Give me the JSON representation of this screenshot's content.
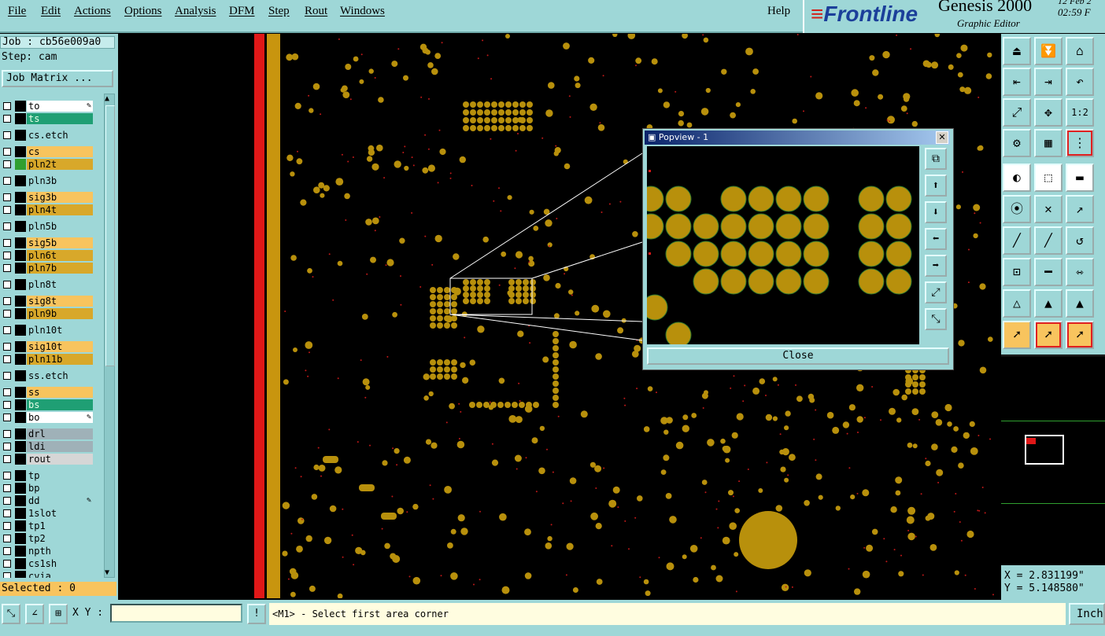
{
  "menu": {
    "items": [
      "File",
      "Edit",
      "Actions",
      "Options",
      "Analysis",
      "DFM",
      "Step",
      "Rout",
      "Windows"
    ],
    "help": "Help"
  },
  "brand": {
    "logo": "Frontline",
    "title": "Genesis 2000",
    "subtitle": "Graphic Editor",
    "date": "12 Feb 2",
    "time": "02:59 F"
  },
  "job": {
    "job_line": "Job : cb56e009a0",
    "step_line": "Step: cam",
    "matrix_button": "Job Matrix ..."
  },
  "layers": [
    {
      "name": "to",
      "color": "#ffffff",
      "editable": true
    },
    {
      "name": "ts",
      "color": "#1f9f74",
      "editable": false
    },
    {
      "name": "cs.etch",
      "color": "#9ed7d7",
      "editable": false
    },
    {
      "name": "cs",
      "color": "#f8c45e",
      "editable": false
    },
    {
      "name": "pln2t",
      "color": "#d8a82a",
      "swatch": "#2f9f2f",
      "editable": false
    },
    {
      "name": "pln3b",
      "color": "#9ed7d7",
      "editable": false
    },
    {
      "name": "sig3b",
      "color": "#f8c45e",
      "editable": false
    },
    {
      "name": "pln4t",
      "color": "#d8a82a",
      "editable": false
    },
    {
      "name": "pln5b",
      "color": "#9ed7d7",
      "editable": false
    },
    {
      "name": "sig5b",
      "color": "#f8c45e",
      "editable": false
    },
    {
      "name": "pln6t",
      "color": "#d8a82a",
      "editable": false
    },
    {
      "name": "pln7b",
      "color": "#d8a82a",
      "editable": false
    },
    {
      "name": "pln8t",
      "color": "#9ed7d7",
      "editable": false
    },
    {
      "name": "sig8t",
      "color": "#f8c45e",
      "editable": false
    },
    {
      "name": "pln9b",
      "color": "#d8a82a",
      "editable": false
    },
    {
      "name": "pln10t",
      "color": "#9ed7d7",
      "editable": false
    },
    {
      "name": "sig10t",
      "color": "#f8c45e",
      "editable": false
    },
    {
      "name": "pln11b",
      "color": "#d8a82a",
      "editable": false
    },
    {
      "name": "ss.etch",
      "color": "#9ed7d7",
      "editable": false
    },
    {
      "name": "ss",
      "color": "#f8c45e",
      "editable": false
    },
    {
      "name": "bs",
      "color": "#1f9f74",
      "editable": false
    },
    {
      "name": "bo",
      "color": "#ffffff",
      "editable": true
    },
    {
      "name": "drl",
      "color": "#9fb1b8",
      "editable": false
    },
    {
      "name": "ldi",
      "color": "#9fb1b8",
      "editable": false
    },
    {
      "name": "rout",
      "color": "#d6d6d6",
      "editable": false
    },
    {
      "name": "tp",
      "color": "#9ed7d7",
      "editable": false
    },
    {
      "name": "bp",
      "color": "#9ed7d7",
      "editable": false
    },
    {
      "name": "dd",
      "color": "#9ed7d7",
      "editable": true
    },
    {
      "name": "1slot",
      "color": "#9ed7d7",
      "editable": false
    },
    {
      "name": "tp1",
      "color": "#9ed7d7",
      "editable": false
    },
    {
      "name": "tp2",
      "color": "#9ed7d7",
      "editable": false
    },
    {
      "name": "npth",
      "color": "#9ed7d7",
      "editable": false
    },
    {
      "name": "cs1sh",
      "color": "#9ed7d7",
      "editable": false
    },
    {
      "name": "cvia",
      "color": "#9ed7d7",
      "editable": false
    }
  ],
  "selected": "Selected : 0",
  "popview": {
    "title": "Popview - 1",
    "close_label": "Close"
  },
  "coords": {
    "x": "X = 2.831199\"",
    "y": "Y = 5.148580\""
  },
  "status": {
    "xy_label": "X Y :",
    "xy_value": "",
    "prompt": "<M1> - Select first area corner",
    "units": "Inch",
    "alert": "!"
  },
  "colors": {
    "panel": "#9ed7d7",
    "pad": "#b8900c",
    "board_edge": "#c8950f",
    "red_strip": "#e01818"
  }
}
